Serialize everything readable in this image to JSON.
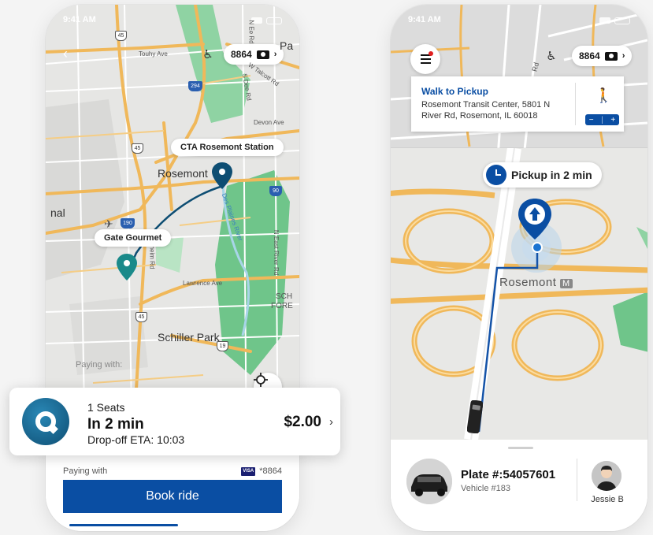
{
  "colors": {
    "brand_blue": "#0a4ea3",
    "teal_pin": "#1a8a8a",
    "map_bg": "#e6e6e4",
    "road_orange": "#f0b85a",
    "park_green": "#6fc58a"
  },
  "left_phone": {
    "status": {
      "time": "9:41 AM"
    },
    "vehicle_chip": {
      "number": "8864",
      "accessibility_icon": "wheelchair-icon",
      "camera_icon": "camera-icon"
    },
    "map_labels": {
      "station": "CTA Rosemont Station",
      "origin": "Gate Gourmet",
      "city": "Rosemont",
      "park": "Schiller Park",
      "touhy": "Touhy Ave",
      "devon": "Devon Ave",
      "lawrence": "Lawrence Ave",
      "des_plaines": "Des Plaines River",
      "river_rd": "N East River Rd",
      "hwy45": "45",
      "hwy294": "294",
      "hwy90": "90",
      "hwy190": "190",
      "hwy19": "19",
      "partial_nal": "nal",
      "partial_pa": "Pa",
      "partial_sch": "SCH",
      "partial_fore": "FORE",
      "partial_heim": "heim Rd",
      "partial_deerd": "S Dee Rd",
      "partial_talcott": "W Talcott Rd",
      "partial_nee": "N Ee Rd"
    },
    "paying_faded": "Paying with:",
    "ride_card": {
      "seats": "1 Seats",
      "eta_headline": "In 2 min",
      "dropoff": "Drop-off ETA: 10:03",
      "price": "$2.00",
      "chevron": "›"
    },
    "payment": {
      "label": "Paying with",
      "card_brand": "VISA",
      "card_last4": "*8864"
    },
    "book_button": "Book ride"
  },
  "right_phone": {
    "status": {
      "time": "9:41 AM"
    },
    "vehicle_chip": {
      "number": "8864"
    },
    "walk_card": {
      "title": "Walk to Pickup",
      "address": "Rosemont Transit Center, 5801 N River Rd, Rosemont, IL 60018",
      "zoom_minus": "−",
      "zoom_plus": "+"
    },
    "pickup_pill": "Pickup in 2 min",
    "map_labels": {
      "rosemont": "Rosemont",
      "metro": "M",
      "rd": "Rd"
    },
    "vehicle": {
      "plate": "Plate #:54057601",
      "vehicle_number": "Vehicle #183"
    },
    "driver": {
      "name": "Jessie B"
    }
  }
}
